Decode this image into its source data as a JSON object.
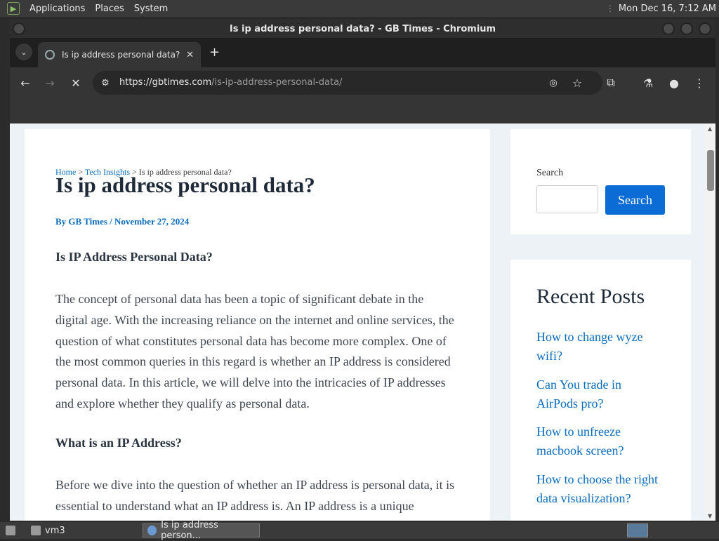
{
  "system": {
    "menus": [
      "Applications",
      "Places",
      "System"
    ],
    "clock": "Mon Dec 16,  7:12 AM"
  },
  "window": {
    "title": "Is ip address personal data? - GB Times - Chromium"
  },
  "tabs": [
    {
      "label": "Is ip address personal data?",
      "active": true
    }
  ],
  "toolbar": {
    "url_host": "https://gbtimes.com",
    "url_path": "/is-ip-address-personal-data/"
  },
  "page": {
    "breadcrumb": {
      "home": "Home",
      "sep1": " > ",
      "category": "Tech Insights",
      "sep2": " > ",
      "current": "Is ip address personal data?"
    },
    "title": "Is ip address personal data?",
    "byline": "By GB Times / November 27, 2024",
    "section1_heading": "Is IP Address Personal Data?",
    "paragraph1_lines": [
      "The concept of personal data has been a topic of significant debate in the",
      "digital age. With the increasing reliance on the internet and online services, the",
      "question of what constitutes personal data has become more complex. One of",
      "the most common queries in this regard is whether an IP address is considered",
      "personal data. In this article, we will delve into the intricacies of IP addresses",
      "and explore whether they qualify as personal data."
    ],
    "section2_heading": "What is an IP Address?",
    "paragraph2_lines": [
      "Before we dive into the question of whether an IP address is personal data, it is",
      "essential to understand what an IP address is. An IP address is a unique"
    ]
  },
  "sidebar": {
    "search_label": "Search",
    "search_value": "",
    "search_button": "Search",
    "recent_title": "Recent Posts",
    "recent_posts": [
      [
        "How to change wyze",
        "wifi?"
      ],
      [
        "Can You trade in",
        "AirPods pro?"
      ],
      [
        "How to unfreeze",
        "macbook screen?"
      ],
      [
        "How to choose the right",
        "data visualization?"
      ]
    ]
  },
  "taskbar": {
    "items": [
      "vm3",
      "Is ip address person..."
    ]
  }
}
